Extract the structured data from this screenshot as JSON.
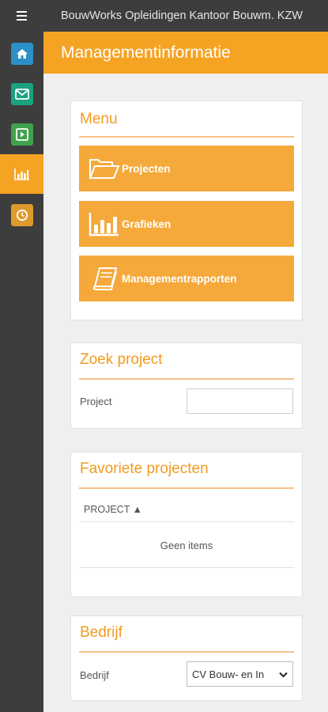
{
  "app": {
    "title": "BouwWorks Opleidingen Kantoor Bouwm. KZW"
  },
  "sidebar": {
    "items": [
      {
        "name": "home",
        "icon": "home-icon",
        "color": "#2d8fc7"
      },
      {
        "name": "mail",
        "icon": "envelope-icon",
        "color": "#1aa180"
      },
      {
        "name": "play",
        "icon": "play-icon",
        "color": "#3fa34d"
      },
      {
        "name": "reports",
        "icon": "bar-chart-icon",
        "color": "#f5a323",
        "active": true
      },
      {
        "name": "clock",
        "icon": "clock-icon",
        "color": "#e09a2c"
      }
    ]
  },
  "header": {
    "title": "Managementinformatie",
    "color": "#f5a323"
  },
  "menu_panel": {
    "title": "Menu",
    "buttons": [
      {
        "label": "Projecten",
        "icon": "folder-icon"
      },
      {
        "label": "Grafieken",
        "icon": "bar-chart-icon"
      },
      {
        "label": "Managementrapporten",
        "icon": "book-icon"
      }
    ]
  },
  "search_panel": {
    "title": "Zoek project",
    "field_label": "Project",
    "field_value": ""
  },
  "favorites_panel": {
    "title": "Favoriete projecten",
    "column_header": "PROJECT ▲",
    "empty_text": "Geen items"
  },
  "company_panel": {
    "title": "Bedrijf",
    "field_label": "Bedrijf",
    "selected_value": "CV Bouw- en In"
  }
}
